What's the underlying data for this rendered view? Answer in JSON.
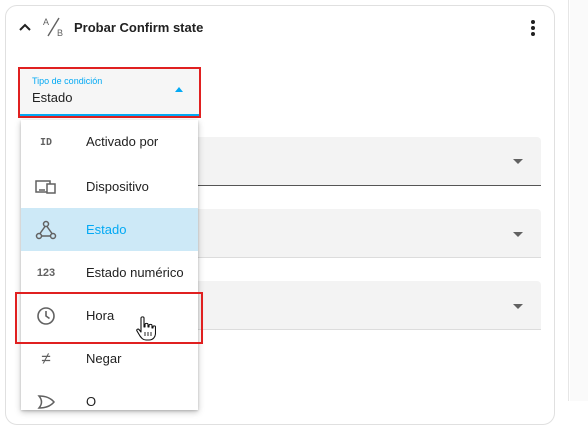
{
  "card": {
    "title": "Probar Confirm state",
    "collapse_icon": "chevron-up-icon",
    "type_icon": "a-b-icon",
    "menu_icon": "kebab-menu-icon"
  },
  "condition_select": {
    "label": "Tipo de condición",
    "value": "Estado",
    "caret_icon": "caret-up-icon"
  },
  "menu": {
    "items": [
      {
        "label": "Activado por",
        "icon": "id-icon",
        "icon_text": "ID"
      },
      {
        "label": "Dispositivo",
        "icon": "devices-icon"
      },
      {
        "label": "Estado",
        "icon": "state-graph-icon",
        "selected": true
      },
      {
        "label": "Estado numérico",
        "icon": "numeric-icon",
        "icon_text": "123"
      },
      {
        "label": "Hora",
        "icon": "clock-icon"
      },
      {
        "label": "Negar",
        "icon": "not-equal-icon",
        "icon_text": "≠"
      },
      {
        "label": "O",
        "icon": "or-gate-icon"
      }
    ]
  },
  "colors": {
    "accent": "#03a9f4",
    "highlight_border": "#e02020",
    "selected_bg": "#cde9f7"
  }
}
